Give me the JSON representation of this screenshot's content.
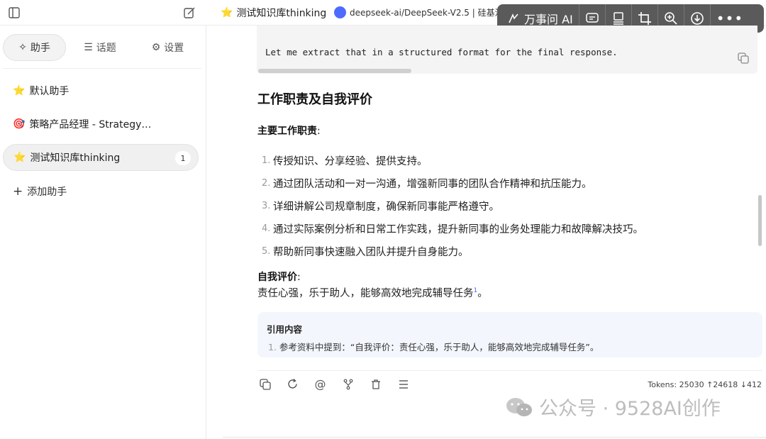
{
  "topbar": {
    "tab1_title": "测试知识库thinking",
    "tab2_title": "deepseek-ai/DeepSeek-V2.5 | 硅基流动"
  },
  "overlay": {
    "ai_label": "万事问 AI"
  },
  "sidebar": {
    "tabs": [
      {
        "label": "助手",
        "icon": "sparkle-icon"
      },
      {
        "label": "话题",
        "icon": "list-icon"
      },
      {
        "label": "设置",
        "icon": "gear-icon"
      }
    ],
    "assistants": [
      {
        "emoji": "⭐",
        "name": "默认助手"
      },
      {
        "emoji": "🎯",
        "name": "策略产品经理 - Strategy…"
      },
      {
        "emoji": "⭐",
        "name": "测试知识库thinking",
        "badge": "1"
      }
    ],
    "add_label": "添加助手"
  },
  "message": {
    "code_text": "Let me extract that in a structured format for the final response.",
    "heading": "工作职责及自我评价",
    "duties_label": "主要工作职责",
    "colon": ":",
    "duties": [
      {
        "num": "1.",
        "text": "传授知识、分享经验、提供支持。"
      },
      {
        "num": "2.",
        "text": "通过团队活动和一对一沟通，增强新同事的团队合作精神和抗压能力。"
      },
      {
        "num": "3.",
        "text": "详细讲解公司规章制度，确保新同事能严格遵守。"
      },
      {
        "num": "4.",
        "text": "通过实际案例分析和日常工作实践，提升新同事的业务处理能力和故障解决技巧。"
      },
      {
        "num": "5.",
        "text": "帮助新同事快速融入团队并提升自身能力。"
      }
    ],
    "eval_label": "自我评价",
    "eval_text": "责任心强，乐于助人，能够高效地完成辅导任务",
    "eval_sup": "1",
    "eval_end": "。",
    "citation": {
      "title": "引用内容",
      "num": "1.",
      "text": "参考资料中提到：“自我评价：责任心强，乐于助人，能够高效地完成辅导任务”。"
    },
    "tokens": "Tokens: 25030 ↑24618 ↓412"
  },
  "watermark": "公众号 · 9528AI创作"
}
